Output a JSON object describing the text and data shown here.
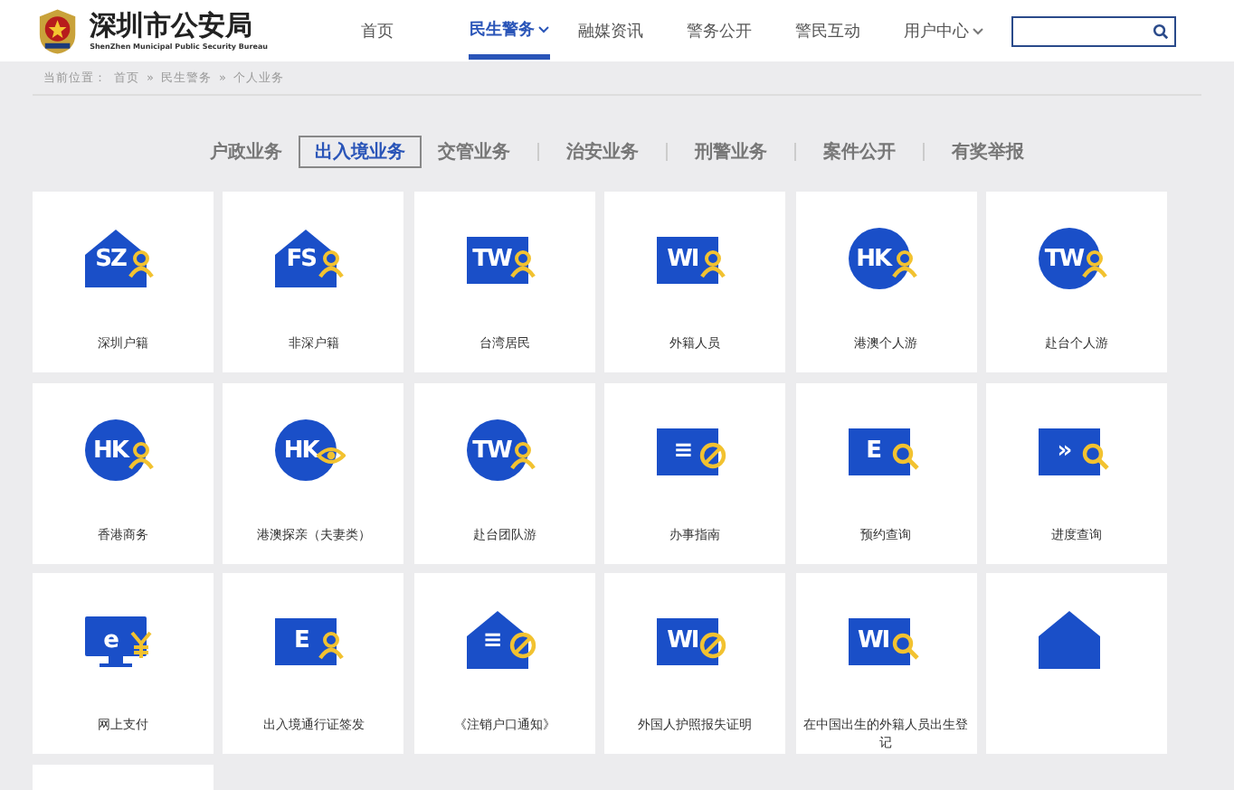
{
  "header": {
    "title": "深圳市公安局",
    "subtitle": "ShenZhen Municipal Public Security Bureau"
  },
  "nav": [
    {
      "label": "首页",
      "selected": false,
      "dropdown": false
    },
    {
      "label": "民生警务",
      "selected": true,
      "dropdown": true
    },
    {
      "label": "融媒资讯",
      "selected": false,
      "dropdown": false
    },
    {
      "label": "警务公开",
      "selected": false,
      "dropdown": false
    },
    {
      "label": "警民互动",
      "selected": false,
      "dropdown": false
    },
    {
      "label": "用户中心",
      "selected": false,
      "dropdown": true
    }
  ],
  "breadcrumb": {
    "prefix": "当前位置：",
    "items": [
      "首页",
      "民生警务",
      "个人业务"
    ],
    "separator": "»"
  },
  "tabs": [
    {
      "label": "户政业务",
      "selected": false
    },
    {
      "label": "出入境业务",
      "selected": true
    },
    {
      "label": "交管业务",
      "selected": false
    },
    {
      "label": "治安业务",
      "selected": false
    },
    {
      "label": "刑警业务",
      "selected": false
    },
    {
      "label": "案件公开",
      "selected": false
    },
    {
      "label": "有奖举报",
      "selected": false
    }
  ],
  "tiles": [
    {
      "kind": "service",
      "label": "深圳户籍",
      "icon": {
        "kind": "house",
        "letters": "SZ"
      },
      "badge": {
        "kind": "person"
      }
    },
    {
      "kind": "service",
      "label": "非深户籍",
      "icon": {
        "kind": "house",
        "letters": "FS"
      },
      "badge": {
        "kind": "person"
      }
    },
    {
      "kind": "service",
      "label": "台湾居民",
      "icon": {
        "kind": "square",
        "letters": "TW"
      },
      "badge": {
        "kind": "person"
      }
    },
    {
      "kind": "service",
      "label": "外籍人员",
      "icon": {
        "kind": "square",
        "letters": "WI"
      },
      "badge": {
        "kind": "person"
      }
    },
    {
      "kind": "service",
      "label": "港澳个人游",
      "icon": {
        "kind": "circle",
        "letters": "HK"
      },
      "badge": {
        "kind": "person"
      }
    },
    {
      "kind": "service",
      "label": "赴台个人游",
      "icon": {
        "kind": "circle",
        "letters": "TW"
      },
      "badge": {
        "kind": "person"
      }
    },
    {
      "kind": "service",
      "label": "香港商务",
      "icon": {
        "kind": "circle",
        "letters": "HK"
      },
      "badge": {
        "kind": "person"
      }
    },
    {
      "kind": "service",
      "label": "港澳探亲（夫妻类）",
      "icon": {
        "kind": "circle",
        "letters": "HK"
      },
      "badge": {
        "kind": "eye"
      }
    },
    {
      "kind": "service",
      "label": "赴台团队游",
      "icon": {
        "kind": "circle",
        "letters": "TW"
      },
      "badge": {
        "kind": "person"
      }
    },
    {
      "kind": "service",
      "label": "办事指南",
      "icon": {
        "kind": "square",
        "letters": "≡"
      },
      "badge": {
        "kind": "ban"
      }
    },
    {
      "kind": "service",
      "label": "预约查询",
      "icon": {
        "kind": "square",
        "letters": "E"
      },
      "badge": {
        "kind": "search"
      }
    },
    {
      "kind": "service",
      "label": "进度查询",
      "icon": {
        "kind": "square",
        "letters": "»"
      },
      "badge": {
        "kind": "search"
      }
    },
    {
      "kind": "service",
      "label": "网上支付",
      "icon": {
        "kind": "monitor",
        "letters": "e"
      },
      "badge": {
        "kind": "yen"
      }
    },
    {
      "kind": "service",
      "label": "出入境通行证签发",
      "icon": {
        "kind": "square",
        "letters": "E"
      },
      "badge": {
        "kind": "person"
      }
    },
    {
      "kind": "service",
      "label": "《注销户口通知》",
      "icon": {
        "kind": "house",
        "letters": "≡"
      },
      "badge": {
        "kind": "ban"
      }
    },
    {
      "kind": "service",
      "label": "外国人护照报失证明",
      "icon": {
        "kind": "square",
        "letters": "WI"
      },
      "badge": {
        "kind": "ban"
      }
    },
    {
      "kind": "service",
      "label": "在中国出生的外籍人员出生登记",
      "icon": {
        "kind": "square",
        "letters": "WI"
      },
      "badge": {
        "kind": "search"
      }
    },
    {
      "kind": "service",
      "icon": {
        "kind": "house"
      }
    },
    {
      "kind": "blank"
    }
  ]
}
